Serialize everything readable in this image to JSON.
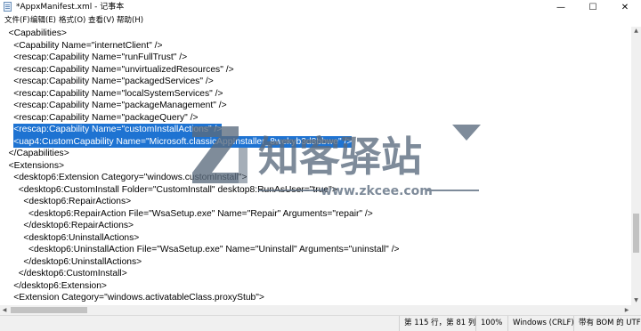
{
  "window": {
    "title": "*AppxManifest.xml - 记事本",
    "minimize_glyph": "—",
    "maximize_glyph": "☐",
    "close_glyph": "✕"
  },
  "menu": [
    "文件(F)",
    "编辑(E)",
    "格式(O)",
    "查看(V)",
    "帮助(H)"
  ],
  "lines": [
    {
      "text": "<Capabilities>",
      "indent": 1,
      "selected": false
    },
    {
      "text": "<Capability Name=\"internetClient\" />",
      "indent": 2,
      "selected": false
    },
    {
      "text": "<rescap:Capability Name=\"runFullTrust\" />",
      "indent": 2,
      "selected": false
    },
    {
      "text": "<rescap:Capability Name=\"unvirtualizedResources\" />",
      "indent": 2,
      "selected": false
    },
    {
      "text": "<rescap:Capability Name=\"packagedServices\" />",
      "indent": 2,
      "selected": false
    },
    {
      "text": "<rescap:Capability Name=\"localSystemServices\" />",
      "indent": 2,
      "selected": false
    },
    {
      "text": "<rescap:Capability Name=\"packageManagement\" />",
      "indent": 2,
      "selected": false
    },
    {
      "text": "<rescap:Capability Name=\"packageQuery\" />",
      "indent": 2,
      "selected": false
    },
    {
      "text": "<rescap:Capability Name=\"customInstallActions\" />",
      "indent": 2,
      "selected": true
    },
    {
      "text": "<uap4:CustomCapability Name=\"Microsoft.classicAppInstaller_8wekyb3d8bbwe\" />",
      "indent": 2,
      "selected": true
    },
    {
      "text": "</Capabilities>",
      "indent": 1,
      "selected": false
    },
    {
      "text": "<Extensions>",
      "indent": 1,
      "selected": false
    },
    {
      "text": "<desktop6:Extension Category=\"windows.customInstall\">",
      "indent": 2,
      "selected": false
    },
    {
      "text": "<desktop6:CustomInstall Folder=\"CustomInstall\" desktop8:RunAsUser=\"true\">",
      "indent": 3,
      "selected": false
    },
    {
      "text": "<desktop6:RepairActions>",
      "indent": 4,
      "selected": false
    },
    {
      "text": "<desktop6:RepairAction File=\"WsaSetup.exe\" Name=\"Repair\" Arguments=\"repair\" />",
      "indent": 5,
      "selected": false
    },
    {
      "text": "</desktop6:RepairActions>",
      "indent": 4,
      "selected": false
    },
    {
      "text": "<desktop6:UninstallActions>",
      "indent": 4,
      "selected": false
    },
    {
      "text": "<desktop6:UninstallAction File=\"WsaSetup.exe\" Name=\"Uninstall\" Arguments=\"uninstall\" />",
      "indent": 5,
      "selected": false
    },
    {
      "text": "</desktop6:UninstallActions>",
      "indent": 4,
      "selected": false
    },
    {
      "text": "</desktop6:CustomInstall>",
      "indent": 3,
      "selected": false
    },
    {
      "text": "</desktop6:Extension>",
      "indent": 2,
      "selected": false
    },
    {
      "text": "<Extension Category=\"windows.activatableClass.proxyStub\">",
      "indent": 2,
      "selected": false
    }
  ],
  "status": {
    "position": "第 115 行，第 81 列",
    "zoom": "100%",
    "line_ending": "Windows (CRLF)",
    "encoding": "带有 BOM 的 UTF-8"
  },
  "watermark": {
    "brand": "知客驿站",
    "url": "www.zkcee.com"
  },
  "colors": {
    "selection": "#1e73d2",
    "watermark": "#5b6b7e"
  }
}
